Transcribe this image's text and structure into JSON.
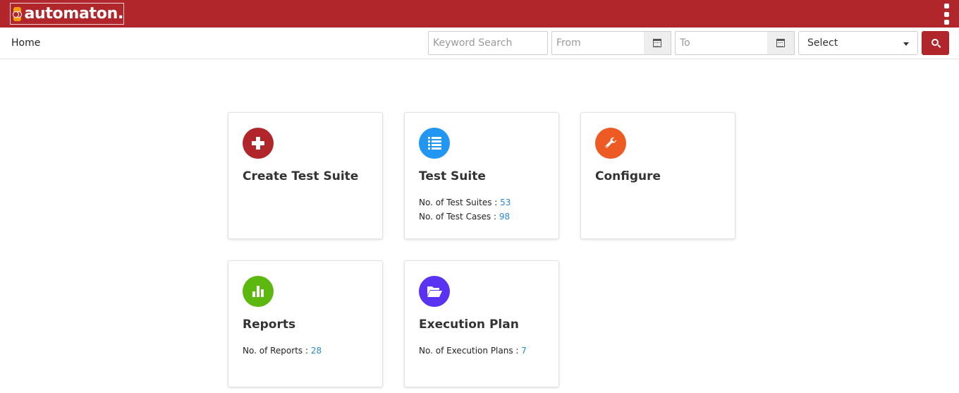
{
  "app": {
    "logo_text": "automaton."
  },
  "breadcrumb": "Home",
  "filters": {
    "keyword_placeholder": "Keyword Search",
    "from_placeholder": "From",
    "to_placeholder": "To",
    "select_value": "Select"
  },
  "cards": {
    "create": {
      "title": "Create Test Suite",
      "icon": "plus-icon",
      "color": "#b1262b"
    },
    "suite": {
      "title": "Test Suite",
      "icon": "list-icon",
      "color": "#2196f3",
      "stats": [
        {
          "label": "No. of Test Suites :",
          "value": "53"
        },
        {
          "label": "No. of Test Cases :",
          "value": "98"
        }
      ]
    },
    "configure": {
      "title": "Configure",
      "icon": "wrench-icon",
      "color": "#ee5a24"
    },
    "reports": {
      "title": "Reports",
      "icon": "bar-chart-icon",
      "color": "#5cb80f",
      "stats": [
        {
          "label": "No. of Reports :",
          "value": "28"
        }
      ]
    },
    "execution": {
      "title": "Execution Plan",
      "icon": "folder-open-icon",
      "color": "#5a33f2",
      "stats": [
        {
          "label": "No. of Execution Plans :",
          "value": "7"
        }
      ]
    }
  },
  "colors": {
    "brand": "#b1262b",
    "link": "#2a8ad6"
  }
}
